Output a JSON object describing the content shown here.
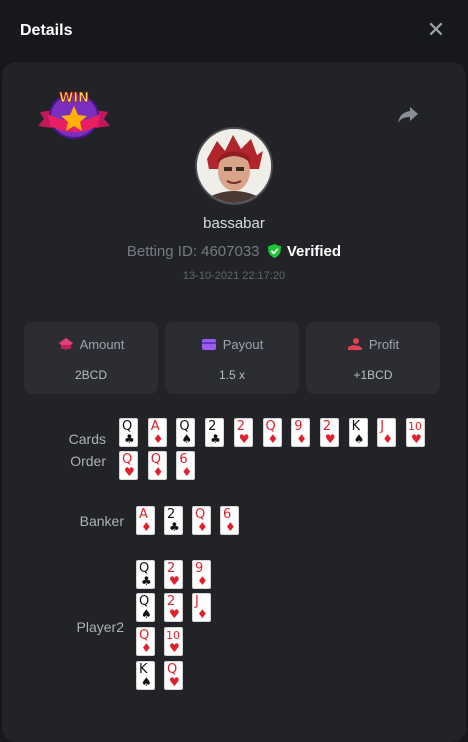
{
  "header": {
    "title": "Details",
    "close_icon": "close-icon"
  },
  "badge": {
    "text": "WIN"
  },
  "user": {
    "name": "bassabar",
    "betting_label": "Betting ID: 4607033",
    "verified_label": "Verified",
    "timestamp": "13-10-2021 22:17:20"
  },
  "stats": [
    {
      "label": "Amount",
      "value": "2BCD",
      "icon": "amount-icon",
      "color": "#e0407a"
    },
    {
      "label": "Payout",
      "value": "1.5 x",
      "icon": "wallet-icon",
      "color": "#9b5cf0"
    },
    {
      "label": "Profit",
      "value": "+1BCD",
      "icon": "profit-icon",
      "color": "#e04050"
    }
  ],
  "rows": {
    "cards_order_label_1": "Cards",
    "cards_order_label_2": "Order",
    "banker_label": "Banker",
    "player2_label": "Player2"
  },
  "cards_order": [
    {
      "rank": "Q",
      "suit": "♣"
    },
    {
      "rank": "A",
      "suit": "♦"
    },
    {
      "rank": "Q",
      "suit": "♠"
    },
    {
      "rank": "2",
      "suit": "♣"
    },
    {
      "rank": "2",
      "suit": "♥"
    },
    {
      "rank": "Q",
      "suit": "♦"
    },
    {
      "rank": "9",
      "suit": "♦"
    },
    {
      "rank": "2",
      "suit": "♥"
    },
    {
      "rank": "K",
      "suit": "♠"
    },
    {
      "rank": "J",
      "suit": "♦"
    },
    {
      "rank": "10",
      "suit": "♥"
    },
    {
      "rank": "Q",
      "suit": "♥"
    },
    {
      "rank": "Q",
      "suit": "♦"
    },
    {
      "rank": "6",
      "suit": "♦"
    }
  ],
  "banker": [
    {
      "rank": "A",
      "suit": "♦"
    },
    {
      "rank": "2",
      "suit": "♣"
    },
    {
      "rank": "Q",
      "suit": "♦"
    },
    {
      "rank": "6",
      "suit": "♦"
    }
  ],
  "player2": [
    [
      {
        "rank": "Q",
        "suit": "♣"
      },
      {
        "rank": "2",
        "suit": "♥"
      },
      {
        "rank": "9",
        "suit": "♦"
      }
    ],
    [
      {
        "rank": "Q",
        "suit": "♠"
      },
      {
        "rank": "2",
        "suit": "♥"
      },
      {
        "rank": "J",
        "suit": "♦"
      }
    ],
    [
      {
        "rank": "Q",
        "suit": "♦"
      },
      {
        "rank": "10",
        "suit": "♥"
      }
    ],
    [
      {
        "rank": "K",
        "suit": "♠"
      },
      {
        "rank": "Q",
        "suit": "♥"
      }
    ]
  ],
  "colors": {
    "background": "#17181b",
    "panel": "#222327",
    "box": "#2b2d32",
    "verified_green": "#1fc63b",
    "card_red": "#e0202a"
  }
}
